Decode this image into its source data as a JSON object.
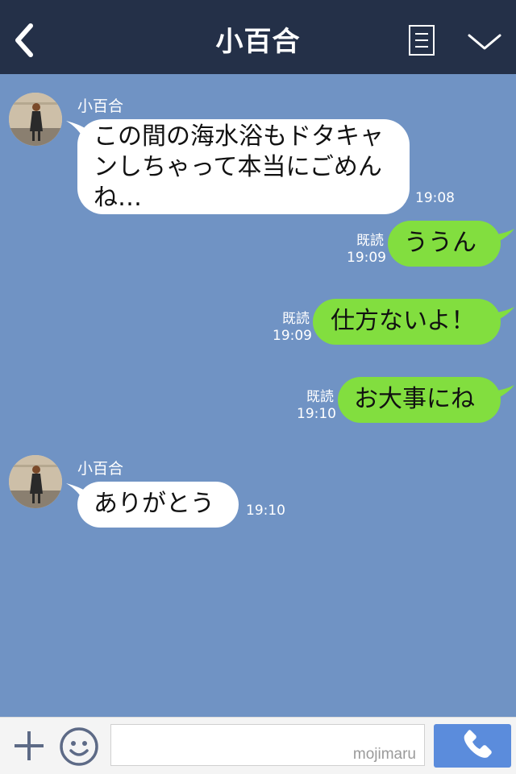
{
  "header": {
    "title": "小百合",
    "back_icon": "chevron-left-icon",
    "menu_icon": "menu-list-icon",
    "collapse_icon": "chevron-down-icon"
  },
  "colors": {
    "header_bg": "#243048",
    "chat_bg": "#7093c4",
    "incoming_bubble": "#ffffff",
    "outgoing_bubble": "#82de3f",
    "call_button": "#5b8cdc"
  },
  "messages": [
    {
      "direction": "incoming",
      "sender": "小百合",
      "lines": [
        "この間の海水浴もドタキャ",
        "ンしちゃって本当にごめん",
        "ね…"
      ],
      "time": "19:08"
    },
    {
      "direction": "outgoing",
      "text": "ううん",
      "read": "既読",
      "time": "19:09"
    },
    {
      "direction": "outgoing",
      "text": "仕方ないよ！",
      "read": "既読",
      "time": "19:09"
    },
    {
      "direction": "outgoing",
      "text": "お大事にね",
      "read": "既読",
      "time": "19:10"
    },
    {
      "direction": "incoming",
      "sender": "小百合",
      "lines": [
        "ありがとう"
      ],
      "time": "19:10"
    }
  ],
  "input_bar": {
    "plus_icon": "plus-icon",
    "emoji_icon": "smiley-icon",
    "input_value": "",
    "watermark": "mojimaru",
    "call_icon": "phone-icon"
  }
}
